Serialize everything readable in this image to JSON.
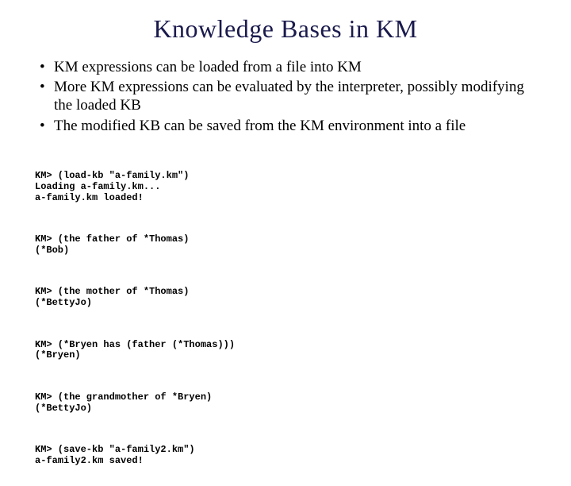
{
  "title": "Knowledge Bases in KM",
  "bullets": {
    "b1": "KM expressions can be loaded from a file into KM",
    "b2": "More KM expressions can be evaluated by the interpreter, possibly modifying the loaded KB",
    "b3": "The modified KB can be saved from the KM environment into a file"
  },
  "code": {
    "g1": "KM> (load-kb \"a-family.km\")\nLoading a-family.km...\na-family.km loaded!",
    "g2": "KM> (the father of *Thomas)\n(*Bob)",
    "g3": "KM> (the mother of *Thomas)\n(*BettyJo)",
    "g4": "KM> (*Bryen has (father (*Thomas)))\n(*Bryen)",
    "g5": "KM> (the grandmother of *Bryen)\n(*BettyJo)",
    "g6": "KM> (save-kb \"a-family2.km\")\na-family2.km saved!"
  }
}
